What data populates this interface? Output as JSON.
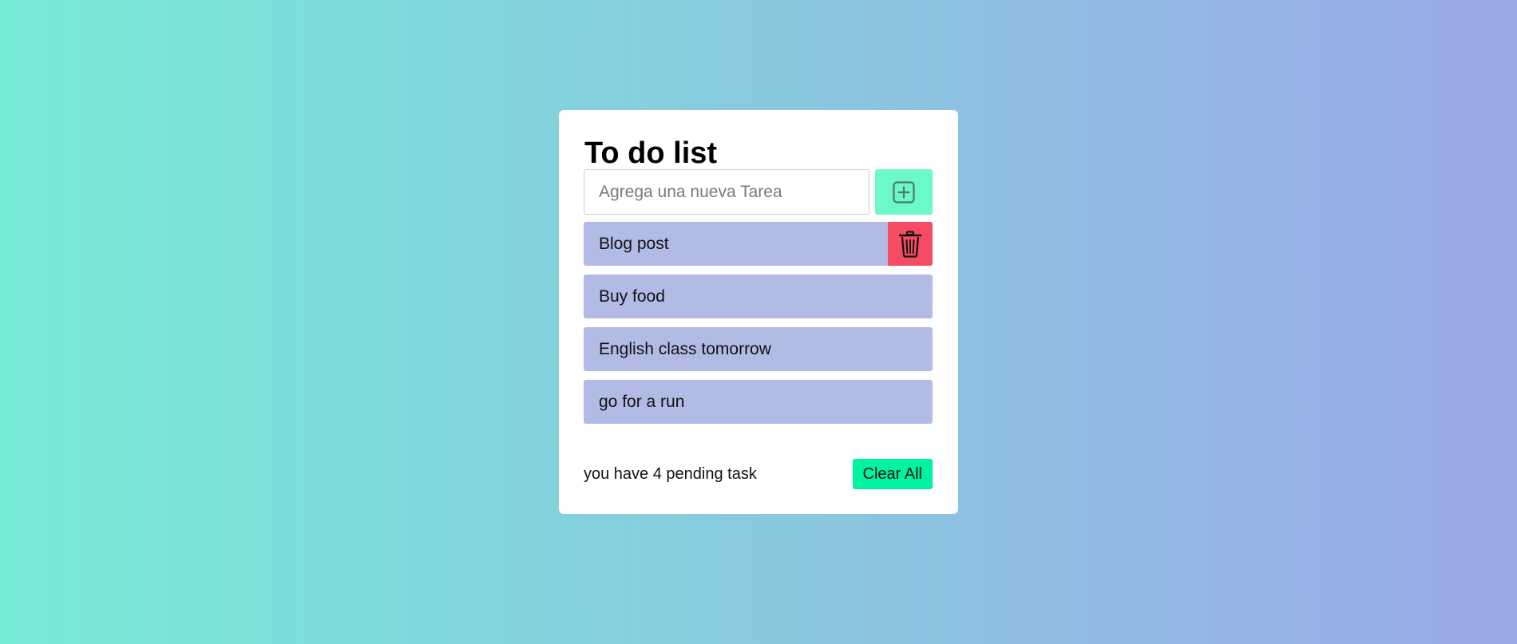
{
  "app": {
    "title": "To do list"
  },
  "input": {
    "placeholder": "Agrega una nueva Tarea",
    "value": ""
  },
  "add_button": {
    "icon": "plus-square-icon"
  },
  "tasks": [
    {
      "label": "Blog post",
      "delete_icon": "trash-icon",
      "delete_visible": true
    },
    {
      "label": "Buy food"
    },
    {
      "label": "English class tomorrow"
    },
    {
      "label": "go for a run"
    }
  ],
  "footer": {
    "pending_text": "you have 4 pending task",
    "clear_label": "Clear All"
  },
  "colors": {
    "background_start": "#76ebd6",
    "background_end": "#9ba8e8",
    "card": "#ffffff",
    "add_button": "#6cf8c8",
    "task_item": "#b2bbe6",
    "delete_button": "#f54b63",
    "clear_button": "#00f3a0"
  }
}
